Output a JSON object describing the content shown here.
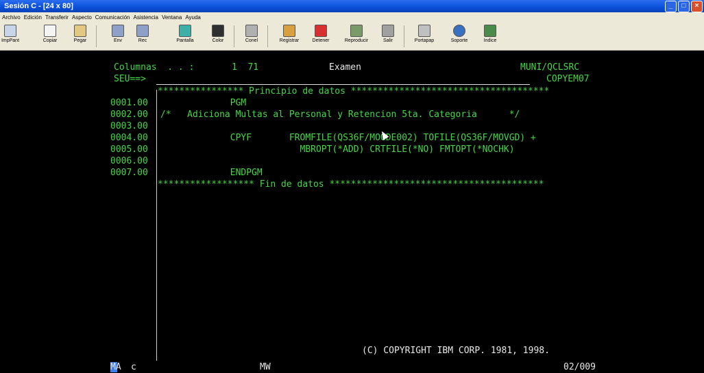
{
  "window": {
    "title": "Sesión C - [24 x 80]"
  },
  "menu": [
    "Archivo",
    "Edición",
    "Transferir",
    "Aspecto",
    "Comunicación",
    "Asistencia",
    "Ventana",
    "Ayuda"
  ],
  "toolbar": [
    "ImpPant",
    "Copiar",
    "Pegar",
    "Env",
    "Rec",
    "Pantalla",
    "Color",
    "Conel",
    "Registrar",
    "Detener",
    "Reproducir",
    "Salir",
    "Portapap",
    "Soporte",
    "Indice"
  ],
  "terminal": {
    "header_columns": "Columnas  . . :",
    "header_range": "1  71",
    "header_mode": "Examen",
    "header_lib": "MUNI/QCLSRC",
    "seu_prompt": "SEU==>",
    "member": "COPYEM07",
    "begin_data": "**************** Principio de datos *************************************",
    "lines": [
      {
        "num": "0001.00",
        "text": "             PGM"
      },
      {
        "num": "0002.00",
        "text": "/*   Adiciona Multas al Personal y Retencion 5ta. Categoria      */"
      },
      {
        "num": "0003.00",
        "text": ""
      },
      {
        "num": "0004.00",
        "text": "             CPYF       FROMFILE(QS36F/MOGDE002) TOFILE(QS36F/MOVGD) +"
      },
      {
        "num": "0005.00",
        "text": "                          MBROPT(*ADD) CRTFILE(*NO) FMTOPT(*NOCHK)"
      },
      {
        "num": "0006.00",
        "text": ""
      },
      {
        "num": "0007.00",
        "text": "             ENDPGM"
      }
    ],
    "end_data": "****************** Fin de datos ****************************************",
    "copyright": "(C) COPYRIGHT IBM CORP. 1981, 1998.",
    "status_left": "MA",
    "status_c": "c",
    "status_mw": "MW",
    "status_pos": "02/009"
  },
  "colors": {
    "terminal_green": "#44d844",
    "background": "#000000"
  }
}
